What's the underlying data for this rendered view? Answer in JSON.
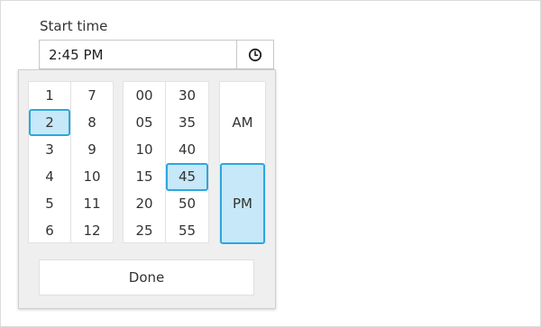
{
  "field": {
    "label": "Start time",
    "value": "2:45 PM",
    "icon": "clock-icon"
  },
  "picker": {
    "hours_left": [
      "1",
      "2",
      "3",
      "4",
      "5",
      "6"
    ],
    "hours_right": [
      "7",
      "8",
      "9",
      "10",
      "11",
      "12"
    ],
    "minutes_left": [
      "00",
      "05",
      "10",
      "15",
      "20",
      "25"
    ],
    "minutes_right": [
      "30",
      "35",
      "40",
      "45",
      "50",
      "55"
    ],
    "am": "AM",
    "pm": "PM",
    "selected_hour": "2",
    "selected_minute": "45",
    "selected_period": "PM",
    "done_label": "Done"
  },
  "colors": {
    "selected_fill": "#c7e8f8",
    "selected_border": "#2ca7df"
  }
}
